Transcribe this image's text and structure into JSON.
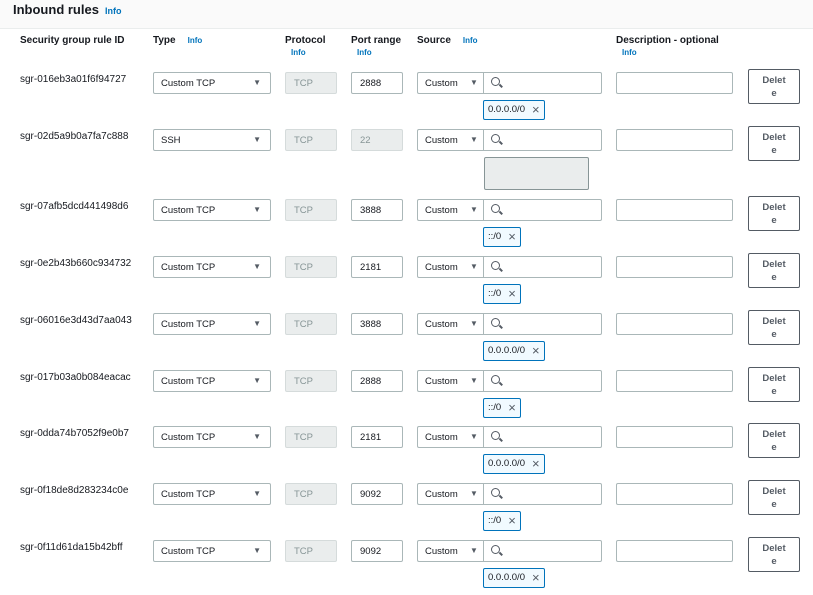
{
  "header": {
    "title": "Inbound rules",
    "info": "Info"
  },
  "columns": {
    "rule_id": "Security group rule ID",
    "type": "Type",
    "type_info": "Info",
    "protocol": "Protocol",
    "protocol_info": "Info",
    "port_range": "Port range",
    "port_info": "Info",
    "source": "Source",
    "source_info": "Info",
    "description": "Description - optional",
    "description_info": "Info"
  },
  "delete_label": "Delete",
  "rows": [
    {
      "id": "sgr-016eb3a01f6f94727",
      "type": "Custom TCP",
      "protocol": "TCP",
      "port": "2888",
      "source": "Custom",
      "cidr": "0.0.0.0/0"
    },
    {
      "id": "sgr-02d5a9b0a7fa7c888",
      "type": "SSH",
      "protocol": "TCP",
      "port": "22",
      "source": "Custom",
      "cidr": ""
    },
    {
      "id": "sgr-07afb5dcd441498d6",
      "type": "Custom TCP",
      "protocol": "TCP",
      "port": "3888",
      "source": "Custom",
      "cidr": "::/0"
    },
    {
      "id": "sgr-0e2b43b660c934732",
      "type": "Custom TCP",
      "protocol": "TCP",
      "port": "2181",
      "source": "Custom",
      "cidr": "::/0"
    },
    {
      "id": "sgr-06016e3d43d7aa043",
      "type": "Custom TCP",
      "protocol": "TCP",
      "port": "3888",
      "source": "Custom",
      "cidr": "0.0.0.0/0"
    },
    {
      "id": "sgr-017b03a0b084eacac",
      "type": "Custom TCP",
      "protocol": "TCP",
      "port": "2888",
      "source": "Custom",
      "cidr": "::/0"
    },
    {
      "id": "sgr-0dda74b7052f9e0b7",
      "type": "Custom TCP",
      "protocol": "TCP",
      "port": "2181",
      "source": "Custom",
      "cidr": "0.0.0.0/0"
    },
    {
      "id": "sgr-0f18de8d283234c0e",
      "type": "Custom TCP",
      "protocol": "TCP",
      "port": "9092",
      "source": "Custom",
      "cidr": "::/0"
    },
    {
      "id": "sgr-0f11d61da15b42bff",
      "type": "Custom TCP",
      "protocol": "TCP",
      "port": "9092",
      "source": "Custom",
      "cidr": "0.0.0.0/0"
    }
  ]
}
